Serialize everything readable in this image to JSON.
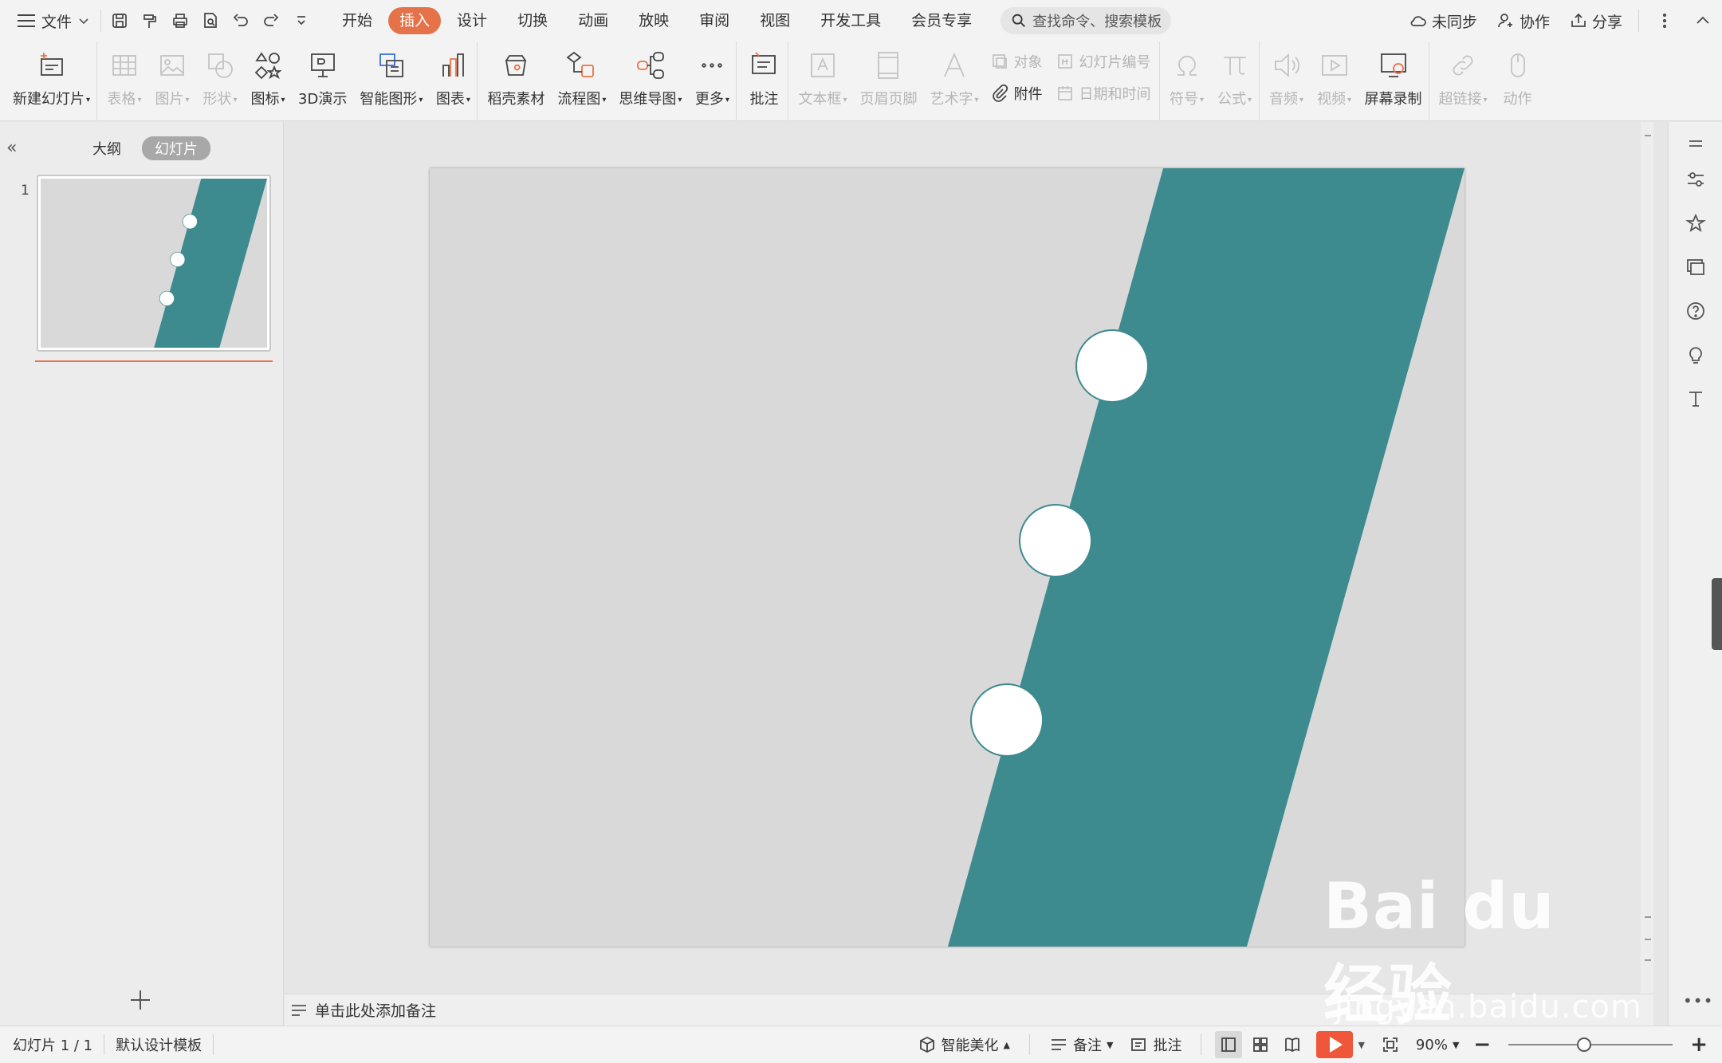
{
  "menu": {
    "file_label": "文件",
    "tabs": [
      "开始",
      "插入",
      "设计",
      "切换",
      "动画",
      "放映",
      "审阅",
      "视图",
      "开发工具",
      "会员专享"
    ],
    "active_tab": "插入",
    "search_placeholder": "查找命令、搜索模板",
    "sync_label": "未同步",
    "collab_label": "协作",
    "share_label": "分享"
  },
  "ribbon": {
    "new_slide": "新建幻灯片",
    "table": "表格",
    "picture": "图片",
    "shape": "形状",
    "icon": "图标",
    "demo3d": "3D演示",
    "smart_graphic": "智能图形",
    "chart": "图表",
    "material": "稻壳素材",
    "flowchart": "流程图",
    "mindmap": "思维导图",
    "more": "更多",
    "comment": "批注",
    "textbox": "文本框",
    "header_footer": "页眉页脚",
    "wordart": "艺术字",
    "object": "对象",
    "attachment": "附件",
    "slide_number": "幻灯片编号",
    "date_time": "日期和时间",
    "symbol": "符号",
    "formula": "公式",
    "audio": "音频",
    "video": "视频",
    "screen_record": "屏幕录制",
    "hyperlink": "超链接",
    "action": "动作"
  },
  "left_panel": {
    "tab_outline": "大纲",
    "tab_slides": "幻灯片",
    "slide_number": "1"
  },
  "notes": {
    "placeholder": "单击此处添加备注"
  },
  "status": {
    "slide_info": "幻灯片 1 / 1",
    "template": "默认设计模板",
    "beautify": "智能美化",
    "notes": "备注",
    "comments": "批注",
    "zoom": "90%"
  },
  "slide": {
    "background_color": "#d9d9d9",
    "band_color": "#3d8a8f",
    "circle_fill": "#ffffff",
    "circle_stroke": "#3d8a8f"
  },
  "watermark": {
    "logo": "Bai du 经验",
    "url": "jingyan.baidu.com"
  }
}
